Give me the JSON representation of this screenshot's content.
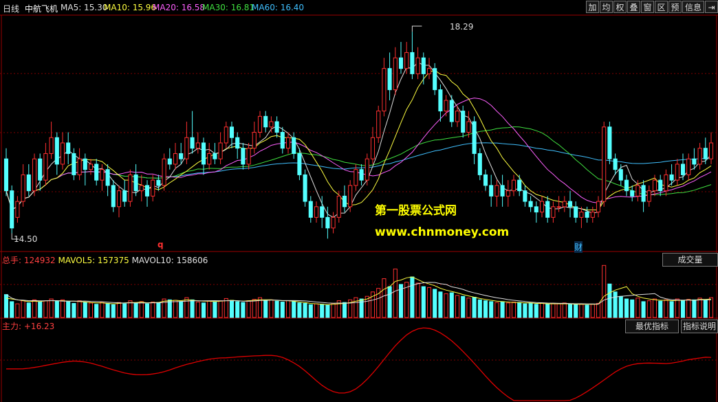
{
  "header": {
    "period": "日线",
    "stock": "中航飞机",
    "ma": [
      {
        "label": "MA5: 15.30",
        "color": "#e0e0e0"
      },
      {
        "label": "MA10: 15.96",
        "color": "#ffff40"
      },
      {
        "label": "MA20: 16.58",
        "color": "#ff60ff"
      },
      {
        "label": "MA30: 16.81",
        "color": "#40e040"
      },
      {
        "label": "MA60: 16.40",
        "color": "#40c0ff"
      }
    ]
  },
  "toolbar": [
    "加",
    "均",
    "权",
    "叠",
    "窗",
    "区",
    "预",
    "信息",
    "⇥"
  ],
  "price_panel": {
    "high_label": "18.29",
    "low_label": "14.50",
    "markers": [
      {
        "text": "q",
        "color": "#ff3030"
      },
      {
        "text": "财",
        "color": "#40c0ff"
      }
    ]
  },
  "watermark": {
    "line1": "第一股票公式网",
    "line2": "www.chnmoney.com"
  },
  "volume_panel": {
    "label_total": "总手:",
    "total": "124932",
    "mavol5": "MAVOL5: 157375",
    "mavol10": "MAVOL10: 158606",
    "button": "成交量"
  },
  "indicator_panel": {
    "label": "主力:",
    "value": "+16.23",
    "buttons": [
      "最优指标",
      "指标说明"
    ]
  },
  "colors": {
    "up": "#ff3030",
    "down": "#54ffff",
    "grid": "#800000",
    "ma5": "#e0e0e0",
    "ma10": "#ffff40",
    "ma20": "#ff60ff",
    "ma30": "#40e040",
    "ma60": "#40c0ff",
    "indicator": "#e00000"
  },
  "chart_data": {
    "type": "candlestick",
    "ylim": [
      14.3,
      18.5
    ],
    "high_mark": 18.29,
    "low_mark": 14.5,
    "candles": [
      [
        15.9,
        15.3,
        16.1,
        15.2
      ],
      [
        15.3,
        14.6,
        15.4,
        14.5
      ],
      [
        14.8,
        15.1,
        15.2,
        14.7
      ],
      [
        15.1,
        15.6,
        15.8,
        15.0
      ],
      [
        15.6,
        15.3,
        15.8,
        15.2
      ],
      [
        15.3,
        15.9,
        16.0,
        15.2
      ],
      [
        15.9,
        15.5,
        16.0,
        15.3
      ],
      [
        15.5,
        16.0,
        16.2,
        15.4
      ],
      [
        16.0,
        16.3,
        16.6,
        15.9
      ],
      [
        16.3,
        15.8,
        16.4,
        15.6
      ],
      [
        15.8,
        16.2,
        16.4,
        15.7
      ],
      [
        16.2,
        16.0,
        16.4,
        15.8
      ],
      [
        16.0,
        15.6,
        16.1,
        15.5
      ],
      [
        15.6,
        15.9,
        16.1,
        15.5
      ],
      [
        15.9,
        15.7,
        16.0,
        15.4
      ],
      [
        15.7,
        15.8,
        15.9,
        15.6
      ],
      [
        15.8,
        15.5,
        15.9,
        15.4
      ],
      [
        15.5,
        15.7,
        15.8,
        15.3
      ],
      [
        15.7,
        15.4,
        15.8,
        15.2
      ],
      [
        15.4,
        15.0,
        15.5,
        14.9
      ],
      [
        15.0,
        15.3,
        15.4,
        14.8
      ],
      [
        15.3,
        15.1,
        15.5,
        15.0
      ],
      [
        15.1,
        15.6,
        15.7,
        15.0
      ],
      [
        15.6,
        15.3,
        15.8,
        15.2
      ],
      [
        15.3,
        15.4,
        15.6,
        15.1
      ],
      [
        15.4,
        15.2,
        15.5,
        15.0
      ],
      [
        15.2,
        15.5,
        15.6,
        15.1
      ],
      [
        15.5,
        15.4,
        15.6,
        15.3
      ],
      [
        15.4,
        15.9,
        16.0,
        15.3
      ],
      [
        15.9,
        15.8,
        16.1,
        15.7
      ],
      [
        15.8,
        16.0,
        16.2,
        15.7
      ],
      [
        16.0,
        15.9,
        16.2,
        15.8
      ],
      [
        15.9,
        16.3,
        16.6,
        15.8
      ],
      [
        16.3,
        16.1,
        16.8,
        16.0
      ],
      [
        16.1,
        16.2,
        16.4,
        16.0
      ],
      [
        16.2,
        15.8,
        16.3,
        15.6
      ],
      [
        15.8,
        16.0,
        16.2,
        15.7
      ],
      [
        16.0,
        15.9,
        16.2,
        15.8
      ],
      [
        15.9,
        16.2,
        16.4,
        15.8
      ],
      [
        16.2,
        16.5,
        16.6,
        16.1
      ],
      [
        16.5,
        16.3,
        16.6,
        16.1
      ],
      [
        16.3,
        16.1,
        16.4,
        15.9
      ],
      [
        16.1,
        15.8,
        16.2,
        15.7
      ],
      [
        15.8,
        16.1,
        16.2,
        15.7
      ],
      [
        16.1,
        16.4,
        16.6,
        16.0
      ],
      [
        16.4,
        16.7,
        16.8,
        16.3
      ],
      [
        16.7,
        16.5,
        16.8,
        16.4
      ],
      [
        16.5,
        16.6,
        16.7,
        16.4
      ],
      [
        16.6,
        16.4,
        16.7,
        16.3
      ],
      [
        16.4,
        16.1,
        16.5,
        16.0
      ],
      [
        16.1,
        16.3,
        16.4,
        16.0
      ],
      [
        16.3,
        16.0,
        16.4,
        15.9
      ],
      [
        16.0,
        15.6,
        16.1,
        15.5
      ],
      [
        15.6,
        15.1,
        15.7,
        15.0
      ],
      [
        15.1,
        14.8,
        15.2,
        14.7
      ],
      [
        14.8,
        15.0,
        15.1,
        14.7
      ],
      [
        15.0,
        14.8,
        15.2,
        14.6
      ],
      [
        14.8,
        14.6,
        15.0,
        14.4
      ],
      [
        14.6,
        14.8,
        14.9,
        14.5
      ],
      [
        14.8,
        15.2,
        15.3,
        14.7
      ],
      [
        15.2,
        15.0,
        15.4,
        14.9
      ],
      [
        15.0,
        15.4,
        15.5,
        14.9
      ],
      [
        15.4,
        15.7,
        15.8,
        15.3
      ],
      [
        15.7,
        15.5,
        15.8,
        15.4
      ],
      [
        15.5,
        15.9,
        16.0,
        15.4
      ],
      [
        15.9,
        16.3,
        16.5,
        15.8
      ],
      [
        16.3,
        16.8,
        16.9,
        16.2
      ],
      [
        16.8,
        17.6,
        17.8,
        16.7
      ],
      [
        17.6,
        17.2,
        17.9,
        17.0
      ],
      [
        17.2,
        17.8,
        18.0,
        17.1
      ],
      [
        17.8,
        17.6,
        18.1,
        17.5
      ],
      [
        17.6,
        17.9,
        18.1,
        17.5
      ],
      [
        17.9,
        17.5,
        18.29,
        17.4
      ],
      [
        17.5,
        17.8,
        18.0,
        17.4
      ],
      [
        17.8,
        17.5,
        17.9,
        17.3
      ],
      [
        17.5,
        17.6,
        17.8,
        17.4
      ],
      [
        17.6,
        17.2,
        17.7,
        17.1
      ],
      [
        17.2,
        16.8,
        17.3,
        16.6
      ],
      [
        16.8,
        17.0,
        17.1,
        16.7
      ],
      [
        17.0,
        16.6,
        17.1,
        16.5
      ],
      [
        16.6,
        16.8,
        16.9,
        16.5
      ],
      [
        16.8,
        16.4,
        16.9,
        16.3
      ],
      [
        16.4,
        16.6,
        16.8,
        16.3
      ],
      [
        16.6,
        16.0,
        16.7,
        15.8
      ],
      [
        16.0,
        15.6,
        16.1,
        15.5
      ],
      [
        15.6,
        15.4,
        15.7,
        15.3
      ],
      [
        15.4,
        15.2,
        15.6,
        15.0
      ],
      [
        15.2,
        15.4,
        15.5,
        15.0
      ],
      [
        15.4,
        15.2,
        15.6,
        15.0
      ],
      [
        15.2,
        15.3,
        15.5,
        15.0
      ],
      [
        15.3,
        15.5,
        15.6,
        15.2
      ],
      [
        15.5,
        15.3,
        15.6,
        15.2
      ],
      [
        15.3,
        15.1,
        15.4,
        15.0
      ],
      [
        15.1,
        15.0,
        15.2,
        14.9
      ],
      [
        15.0,
        14.9,
        15.1,
        14.7
      ],
      [
        14.9,
        15.1,
        15.2,
        14.8
      ],
      [
        15.1,
        14.8,
        15.2,
        14.7
      ],
      [
        14.8,
        15.0,
        15.1,
        14.7
      ],
      [
        15.0,
        15.0,
        15.2,
        14.9
      ],
      [
        15.0,
        15.1,
        15.2,
        14.9
      ],
      [
        15.1,
        15.0,
        15.3,
        14.8
      ],
      [
        15.0,
        14.8,
        15.1,
        14.7
      ],
      [
        14.8,
        14.9,
        15.0,
        14.6
      ],
      [
        14.9,
        14.8,
        15.0,
        14.7
      ],
      [
        14.8,
        14.9,
        15.0,
        14.7
      ],
      [
        14.9,
        15.1,
        15.2,
        14.8
      ],
      [
        15.1,
        16.5,
        16.6,
        15.0
      ],
      [
        16.5,
        15.9,
        16.6,
        15.8
      ],
      [
        15.9,
        15.7,
        16.0,
        15.6
      ],
      [
        15.7,
        15.5,
        15.8,
        15.4
      ],
      [
        15.5,
        15.3,
        15.6,
        15.2
      ],
      [
        15.3,
        15.2,
        15.4,
        15.1
      ],
      [
        15.2,
        15.4,
        15.5,
        15.1
      ],
      [
        15.4,
        15.1,
        15.5,
        14.9
      ],
      [
        15.1,
        15.3,
        15.4,
        15.0
      ],
      [
        15.3,
        15.5,
        15.6,
        15.2
      ],
      [
        15.5,
        15.3,
        15.6,
        15.2
      ],
      [
        15.3,
        15.6,
        15.7,
        15.2
      ],
      [
        15.6,
        15.5,
        15.8,
        15.4
      ],
      [
        15.5,
        15.8,
        15.9,
        15.4
      ],
      [
        15.8,
        15.6,
        16.0,
        15.5
      ],
      [
        15.6,
        15.9,
        16.0,
        15.5
      ],
      [
        15.9,
        15.8,
        16.1,
        15.7
      ],
      [
        15.8,
        16.1,
        16.2,
        15.7
      ],
      [
        16.1,
        15.9,
        16.3,
        15.8
      ],
      [
        15.9,
        16.2,
        16.4,
        15.8
      ]
    ],
    "volume": [
      52,
      36,
      31,
      38,
      33,
      40,
      35,
      38,
      42,
      37,
      40,
      36,
      32,
      38,
      34,
      33,
      30,
      35,
      32,
      29,
      34,
      31,
      38,
      33,
      36,
      31,
      35,
      34,
      42,
      40,
      39,
      36,
      45,
      40,
      35,
      33,
      37,
      35,
      38,
      43,
      39,
      36,
      34,
      38,
      41,
      45,
      39,
      40,
      37,
      35,
      38,
      36,
      33,
      32,
      29,
      31,
      30,
      28,
      32,
      38,
      34,
      40,
      45,
      42,
      48,
      58,
      66,
      88,
      70,
      110,
      75,
      80,
      92,
      78,
      70,
      68,
      64,
      58,
      54,
      56,
      50,
      48,
      44,
      46,
      40,
      38,
      36,
      34,
      36,
      33,
      35,
      34,
      31,
      32,
      30,
      33,
      30,
      32,
      31,
      33,
      31,
      29,
      30,
      28,
      30,
      32,
      118,
      76,
      58,
      48,
      42,
      40,
      44,
      36,
      38,
      42,
      37,
      40,
      36,
      42,
      38,
      41,
      40,
      44,
      39,
      45
    ],
    "mavol5": [
      44,
      42,
      40,
      38,
      36,
      37,
      36,
      38,
      38,
      38,
      38,
      37,
      37,
      36,
      35,
      34,
      33,
      33,
      32,
      31,
      32,
      33,
      34,
      34,
      35,
      33,
      34,
      34,
      37,
      38,
      39,
      38,
      40,
      39,
      38,
      37,
      37,
      36,
      37,
      38,
      39,
      38,
      37,
      38,
      39,
      40,
      40,
      40,
      39,
      38,
      38,
      37,
      35,
      34,
      32,
      31,
      30,
      29,
      30,
      31,
      32,
      34,
      37,
      39,
      42,
      48,
      54,
      64,
      70,
      82,
      85,
      90,
      92,
      86,
      80,
      76,
      72,
      66,
      62,
      59,
      56,
      52,
      49,
      46,
      43,
      41,
      39,
      37,
      36,
      35,
      34,
      34,
      33,
      33,
      32,
      32,
      31,
      31,
      31,
      31,
      31,
      30,
      30,
      30,
      30,
      30,
      48,
      56,
      62,
      66,
      70,
      54,
      48,
      44,
      42,
      40,
      39,
      39,
      38,
      39,
      39,
      40,
      39,
      41,
      41,
      42
    ],
    "indicator_ylim": [
      -45,
      65
    ],
    "indicator_label_value": 16.23
  }
}
